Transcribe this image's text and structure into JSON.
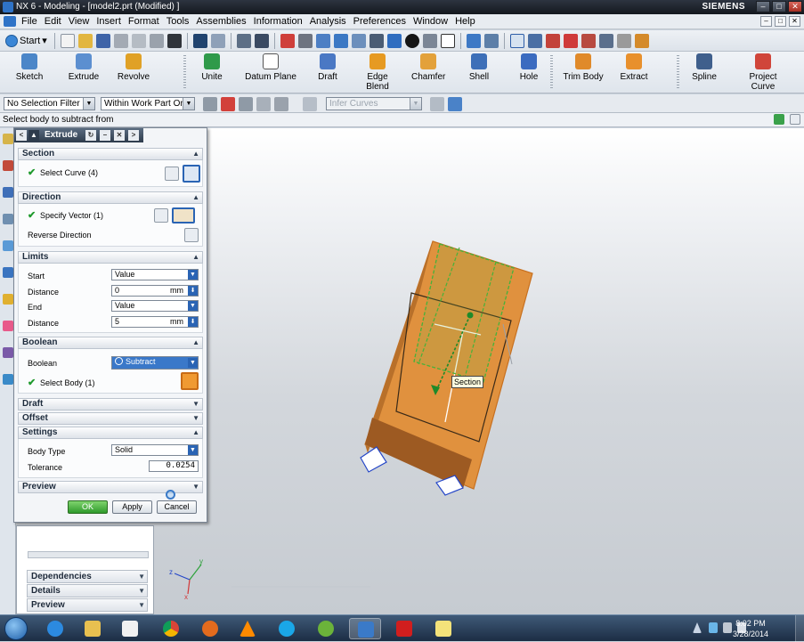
{
  "window": {
    "title": "NX 6 - Modeling - [model2.prt (Modified) ]",
    "brand": "SIEMENS",
    "controls": [
      "–",
      "□",
      "✕"
    ]
  },
  "menubar": {
    "items": [
      "File",
      "Edit",
      "View",
      "Insert",
      "Format",
      "Tools",
      "Assemblies",
      "Information",
      "Analysis",
      "Preferences",
      "Window",
      "Help"
    ]
  },
  "standard_toolbar": {
    "start_label": "Start",
    "start_arrow": "▾"
  },
  "ribbon": {
    "buttons": [
      {
        "label": "Sketch",
        "icon": "sketch-icon",
        "color": "#4b86c8"
      },
      {
        "label": "Extrude",
        "icon": "extrude-icon",
        "color": "#5c8fd0"
      },
      {
        "label": "Revolve",
        "icon": "revolve-icon",
        "color": "#e0a126"
      },
      {
        "label": "Unite",
        "icon": "unite-icon",
        "color": "#2f9a4a"
      },
      {
        "label": "Datum Plane",
        "icon": "datum-plane-icon",
        "color": "#ffffff"
      },
      {
        "label": "Draft",
        "icon": "draft-icon",
        "color": "#4a78c4"
      },
      {
        "label": "Edge Blend",
        "icon": "edge-blend-icon",
        "color": "#e69a22"
      },
      {
        "label": "Chamfer",
        "icon": "chamfer-icon",
        "color": "#e3a13a"
      },
      {
        "label": "Shell",
        "icon": "shell-icon",
        "color": "#3d6fb8"
      },
      {
        "label": "Hole",
        "icon": "hole-icon",
        "color": "#3b6bc0"
      },
      {
        "label": "Trim Body",
        "icon": "trim-body-icon",
        "color": "#e08a2a"
      },
      {
        "label": "Extract",
        "icon": "extract-icon",
        "color": "#e8902c"
      },
      {
        "label": "Spline",
        "icon": "spline-icon",
        "color": "#3f5f8c"
      },
      {
        "label": "Project Curve",
        "icon": "project-curve-icon",
        "color": "#d0453a"
      }
    ]
  },
  "selection_bar": {
    "filter": "No Selection Filter",
    "scope": "Within Work Part Only",
    "curve_rule": "Infer Curves"
  },
  "cue_line": "Select body to subtract from",
  "dialog": {
    "title": "Extrude",
    "nav": [
      "<",
      "↻",
      "–",
      "✕",
      ">"
    ],
    "section": {
      "header": "Section",
      "select_curve": "Select Curve (4)"
    },
    "direction": {
      "header": "Direction",
      "specify_vector": "Specify Vector (1)",
      "reverse": "Reverse Direction"
    },
    "limits": {
      "header": "Limits",
      "start_label": "Start",
      "start_value": "Value",
      "start_distance_label": "Distance",
      "start_distance": "0",
      "start_unit": "mm",
      "end_label": "End",
      "end_value": "Value",
      "end_distance_label": "Distance",
      "end_distance": "5",
      "end_unit": "mm"
    },
    "boolean": {
      "header": "Boolean",
      "label": "Boolean",
      "value": "Subtract",
      "select_body": "Select Body (1)"
    },
    "draft": {
      "header": "Draft"
    },
    "offset": {
      "header": "Offset"
    },
    "settings": {
      "header": "Settings",
      "body_type_label": "Body Type",
      "body_type": "Solid",
      "tolerance_label": "Tolerance",
      "tolerance": "0.0254"
    },
    "preview": {
      "header": "Preview"
    },
    "buttons": {
      "ok": "OK",
      "apply": "Apply",
      "cancel": "Cancel"
    }
  },
  "navigator": {
    "sections": [
      "Dependencies",
      "Details",
      "Preview"
    ]
  },
  "viewport": {
    "tooltip": "Section",
    "triad": {
      "x": "x",
      "y": "y",
      "z": "z"
    },
    "part_color": "#e0913e",
    "highlight_color": "#46b23a"
  },
  "taskbar": {
    "time": "8:02 PM",
    "date": "3/28/2014",
    "apps": [
      "windows-start",
      "internet-explorer",
      "file-explorer",
      "media-player",
      "chrome",
      "firefox",
      "vlc",
      "skype",
      "utorrent",
      "nx6",
      "acrobat",
      "notes"
    ]
  },
  "colors": {
    "accent": "#2a64b4",
    "ok_green": "#2f9a2c",
    "check_green": "#1f9a2d"
  }
}
